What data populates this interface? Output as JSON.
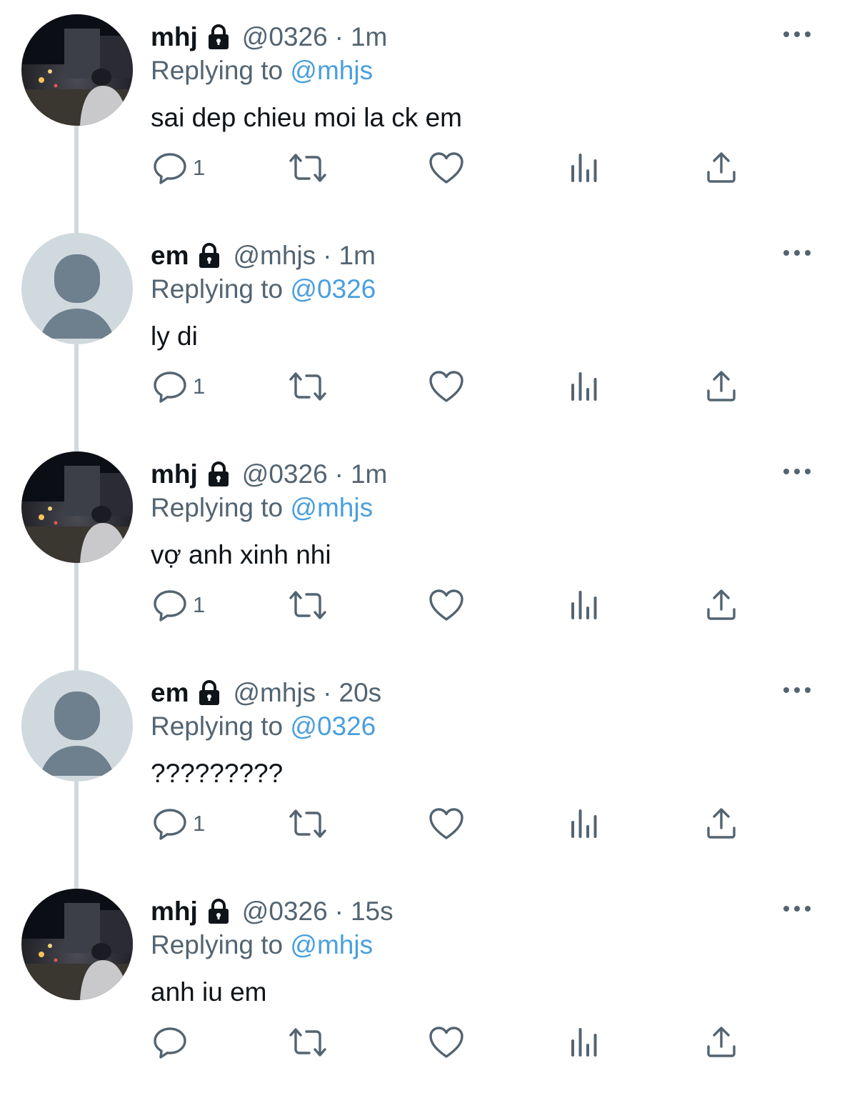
{
  "tweets": [
    {
      "name": "mhj",
      "handle": "@0326",
      "separator": "·",
      "time": "1m",
      "replying_label": "Replying to",
      "replying_to": "@mhjs",
      "text": "sai dep chieu moi la ck em",
      "reply_count": "1",
      "avatar": "photo"
    },
    {
      "name": "em",
      "handle": "@mhjs",
      "separator": "·",
      "time": "1m",
      "replying_label": "Replying to",
      "replying_to": "@0326",
      "text": "ly di",
      "reply_count": "1",
      "avatar": "default"
    },
    {
      "name": "mhj",
      "handle": "@0326",
      "separator": "·",
      "time": "1m",
      "replying_label": "Replying to",
      "replying_to": "@mhjs",
      "text": "vợ anh xinh nhi",
      "reply_count": "1",
      "avatar": "photo"
    },
    {
      "name": "em",
      "handle": "@mhjs",
      "separator": "·",
      "time": "20s",
      "replying_label": "Replying to",
      "replying_to": "@0326",
      "text": "?????????",
      "reply_count": "1",
      "avatar": "default"
    },
    {
      "name": "mhj",
      "handle": "@0326",
      "separator": "·",
      "time": "15s",
      "replying_label": "Replying to",
      "replying_to": "@mhjs",
      "text": "anh iu em",
      "reply_count": "",
      "avatar": "photo"
    }
  ],
  "icons": {
    "reply": "reply-icon",
    "retweet": "retweet-icon",
    "like": "like-icon",
    "views": "views-icon",
    "share": "share-icon",
    "more": "more-icon",
    "lock": "lock-icon"
  },
  "colors": {
    "text": "#0f1419",
    "secondary": "#536471",
    "link": "#4a9fde",
    "thread_line": "#cfd9de",
    "default_avatar_bg": "#cfd9de",
    "default_avatar_fg": "#6e7f8d"
  }
}
